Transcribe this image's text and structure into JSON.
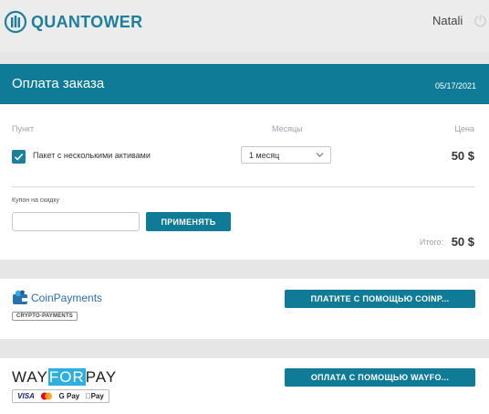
{
  "topbar": {
    "brand": "QUANTOWER",
    "username": "Natali"
  },
  "header": {
    "title": "Оплата заказа",
    "date": "05/17/2021"
  },
  "order": {
    "columns": {
      "item": "Пункт",
      "months": "Месяцы",
      "price": "Цена"
    },
    "item_label": "Пакет с несколькими активами",
    "months_value": "1 месяц",
    "price": "50 $",
    "coupon_label": "Купон на скидку",
    "coupon_placeholder": "",
    "apply_label": "ПРИМЕНЯТЬ",
    "total_label": "Итого:",
    "total_value": "50 $"
  },
  "payments": {
    "coinpayments": {
      "name": "CoinPayments",
      "tag": "CRYPTO-PAYMENTS",
      "button": "ПЛАТИТЕ С ПОМОЩЬЮ COINP..."
    },
    "wayforpay": {
      "logo_left": "WAY",
      "logo_mid": "FOR",
      "logo_right": "PAY",
      "methods": [
        "VISA",
        "mastercard",
        "G Pay",
        "Pay"
      ],
      "button": "ОПЛАТА С ПОМОЩЬЮ WAYFO..."
    }
  },
  "colors": {
    "accent": "#0f7b97",
    "brand": "#1f7f9b",
    "background": "#e6e6e6"
  }
}
